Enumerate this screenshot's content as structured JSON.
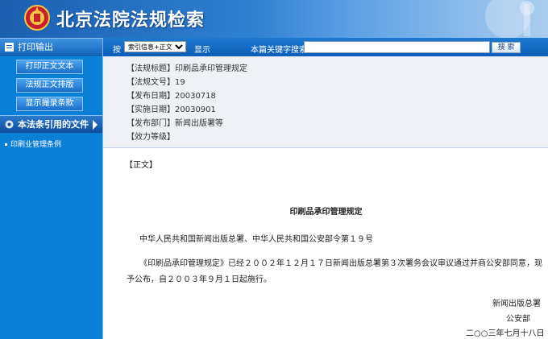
{
  "header": {
    "title": "北京法院法规检索"
  },
  "sidebar": {
    "print_heading": "打印输出",
    "buttons": [
      "打印正文文本",
      "法规正文排版",
      "显示撮录条款"
    ],
    "cited_heading": "本法条引用的文件",
    "cited_items": [
      "印刷业管理条例"
    ]
  },
  "toolbar": {
    "by_label": "按",
    "select_value": "索引信息+正文",
    "show_label": "显示",
    "keyword_label": "本篇关键字搜索:",
    "search_value": "",
    "search_button": "搜 索"
  },
  "meta": [
    {
      "key": "【法规标题】",
      "value": "印刷品承印管理规定"
    },
    {
      "key": "【法规文号】",
      "value": "19"
    },
    {
      "key": "【发布日期】",
      "value": "20030718"
    },
    {
      "key": "【实施日期】",
      "value": "20030901"
    },
    {
      "key": "【发布部门】",
      "value": "新闻出版署等"
    },
    {
      "key": "【效力等级】",
      "value": ""
    }
  ],
  "body": {
    "section_label": "【正文】",
    "doc_title": "印刷品承印管理规定",
    "order_line": "中华人民共和国新闻出版总署、中华人民共和国公安部令第１９号",
    "paragraph_line1": "《印刷品承印管理规定》已经２００２年１２月１７日新闻出版总署第３次署务会议审议通过并商公安部同意，现",
    "paragraph_line2": "予公布，自２００３年９月１日起施行。",
    "signer1": "新闻出版总署",
    "signer2": "公安部",
    "date": "二○○三年七月十八日"
  }
}
